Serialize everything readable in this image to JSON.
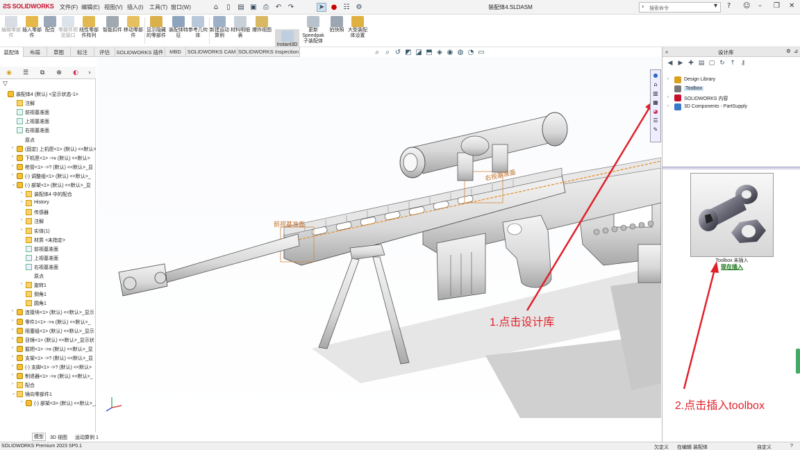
{
  "app": {
    "brand": "SOLIDWORKS",
    "doc_title": "装配体4.SLDASM"
  },
  "menu": [
    "文件(F)",
    "编辑(E)",
    "视图(V)",
    "插入(I)",
    "工具(T)",
    "窗口(W)"
  ],
  "search": {
    "placeholder": "搜索命令"
  },
  "ribbon": {
    "buttons": [
      {
        "label": "编辑零部件",
        "disabled": true
      },
      {
        "label": "插入零部件",
        "disabled": false
      },
      {
        "label": "配合",
        "disabled": false
      },
      {
        "label": "零部件预览窗口",
        "disabled": true
      },
      {
        "label": "线性零部件阵列",
        "disabled": false
      },
      {
        "label": "智能扣件",
        "disabled": false
      },
      {
        "label": "移动零部件",
        "disabled": false
      },
      {
        "label": "显示隐藏的零部件",
        "disabled": false
      },
      {
        "label": "装配体特征",
        "disabled": false
      },
      {
        "label": "参考几何体",
        "disabled": false
      },
      {
        "label": "新建运动算例",
        "disabled": false
      },
      {
        "label": "材料明细表",
        "disabled": false
      },
      {
        "label": "爆炸视图",
        "disabled": false
      },
      {
        "label": "Instant3D",
        "disabled": false
      },
      {
        "label": "更新Speedpak子装配体",
        "disabled": false
      },
      {
        "label": "拍快照",
        "disabled": false
      },
      {
        "label": "大型装配体设置",
        "disabled": false
      }
    ]
  },
  "tabs": [
    "装配体",
    "布局",
    "草图",
    "标注",
    "评估",
    "SOLIDWORKS 插件",
    "MBD",
    "SOLIDWORKS CAM",
    "SOLIDWORKS Inspection"
  ],
  "tree": [
    {
      "label": "装配体4 (默认) <显示状态-1>",
      "level": 0,
      "icon": "comp",
      "exp": ""
    },
    {
      "label": "注解",
      "level": 1,
      "icon": "folder",
      "exp": ""
    },
    {
      "label": "前视基准面",
      "level": 1,
      "icon": "plane",
      "exp": ""
    },
    {
      "label": "上视基准面",
      "level": 1,
      "icon": "plane",
      "exp": ""
    },
    {
      "label": "右视基准面",
      "level": 1,
      "icon": "plane",
      "exp": ""
    },
    {
      "label": "原点",
      "level": 1,
      "icon": "",
      "exp": ""
    },
    {
      "label": "(固定) 上机匣<1> (默认) <<默认>",
      "level": 1,
      "icon": "comp",
      "exp": "›"
    },
    {
      "label": "下机匣<1> ->x (默认) <<默认>",
      "level": 1,
      "icon": "comp",
      "exp": "›"
    },
    {
      "label": "枪管<1> ->? (默认) <<默认>_显",
      "level": 1,
      "icon": "comp",
      "exp": "›"
    },
    {
      "label": "(-) 调整组<1> (默认) <<默认>_",
      "level": 1,
      "icon": "comp",
      "exp": "›"
    },
    {
      "label": "(-) 部架<1> (默认) <<默认>_显",
      "level": 1,
      "icon": "comp",
      "exp": "⌄"
    },
    {
      "label": "装配体4 中的配合",
      "level": 2,
      "icon": "folder",
      "exp": "›"
    },
    {
      "label": "History",
      "level": 2,
      "icon": "folder",
      "exp": "›"
    },
    {
      "label": "传感器",
      "level": 2,
      "icon": "folder",
      "exp": ""
    },
    {
      "label": "注解",
      "level": 2,
      "icon": "folder",
      "exp": "›"
    },
    {
      "label": "实体(1)",
      "level": 2,
      "icon": "folder",
      "exp": "›"
    },
    {
      "label": "材质 <未指定>",
      "level": 2,
      "icon": "folder",
      "exp": ""
    },
    {
      "label": "前视基准面",
      "level": 2,
      "icon": "plane",
      "exp": ""
    },
    {
      "label": "上视基准面",
      "level": 2,
      "icon": "plane",
      "exp": ""
    },
    {
      "label": "右视基准面",
      "level": 2,
      "icon": "plane",
      "exp": ""
    },
    {
      "label": "原点",
      "level": 2,
      "icon": "",
      "exp": ""
    },
    {
      "label": "旋转1",
      "level": 2,
      "icon": "folder",
      "exp": "›"
    },
    {
      "label": "倒角1",
      "level": 2,
      "icon": "folder",
      "exp": ""
    },
    {
      "label": "圆角1",
      "level": 2,
      "icon": "folder",
      "exp": ""
    },
    {
      "label": "连接块<1> (默认) <<默认>_显示",
      "level": 1,
      "icon": "comp",
      "exp": "›"
    },
    {
      "label": "零件1<1> ->x (默认) <<默认>_",
      "level": 1,
      "icon": "comp",
      "exp": "›"
    },
    {
      "label": "阻塞组<1> (默认) <<默认>_显示",
      "level": 1,
      "icon": "comp",
      "exp": "›"
    },
    {
      "label": "目镜<1> (默认) <<默认>_显示状",
      "level": 1,
      "icon": "comp",
      "exp": "›"
    },
    {
      "label": "握把<1> ->x (默认) <<默认>_显",
      "level": 1,
      "icon": "comp",
      "exp": "›"
    },
    {
      "label": "支架<1> ->? (默认) <<默认>_显",
      "level": 1,
      "icon": "comp",
      "exp": "›"
    },
    {
      "label": "(-) 支脚<1> ->? (默认) <<默认>",
      "level": 1,
      "icon": "comp",
      "exp": "›"
    },
    {
      "label": "制退器<1> ->x (默认) <<默认>_",
      "level": 1,
      "icon": "comp",
      "exp": "›"
    },
    {
      "label": "配合",
      "level": 1,
      "icon": "folder",
      "exp": "›"
    },
    {
      "label": "镜向零部件1",
      "level": 1,
      "icon": "folder",
      "exp": "⌄"
    },
    {
      "label": "(-) 部架<3> (默认) <<默认>_显",
      "level": 2,
      "icon": "comp",
      "exp": "›"
    }
  ],
  "bottom_tabs": [
    "模型",
    "3D 视图",
    "运动算例 1"
  ],
  "status": {
    "left": "SOLIDWORKS Premium 2023 SP0.1",
    "s1": "欠定义",
    "s2": "在编辑 装配体",
    "s3": "自定义"
  },
  "design_library": {
    "title": "设计库",
    "items": [
      {
        "label": "Design Library",
        "exp": "›",
        "selected": false,
        "color": "#d9a020"
      },
      {
        "label": "Toolbox",
        "exp": "",
        "selected": true,
        "color": "#777777"
      },
      {
        "label": "SOLIDWORKS 内容",
        "exp": "›",
        "selected": false,
        "color": "#c8102e"
      },
      {
        "label": "3D Components - PartSupply",
        "exp": "›",
        "selected": false,
        "color": "#3a78c8"
      }
    ],
    "toolbox_status": "Toolbox 未插入",
    "insert_link": "现在插入"
  },
  "model_labels": {
    "plane1": "前视基准面",
    "plane2": "右视基准面"
  },
  "annotations": {
    "step1": "1.点击设计库",
    "step2": "2.点击插入toolbox",
    "color": "#e0202a"
  }
}
